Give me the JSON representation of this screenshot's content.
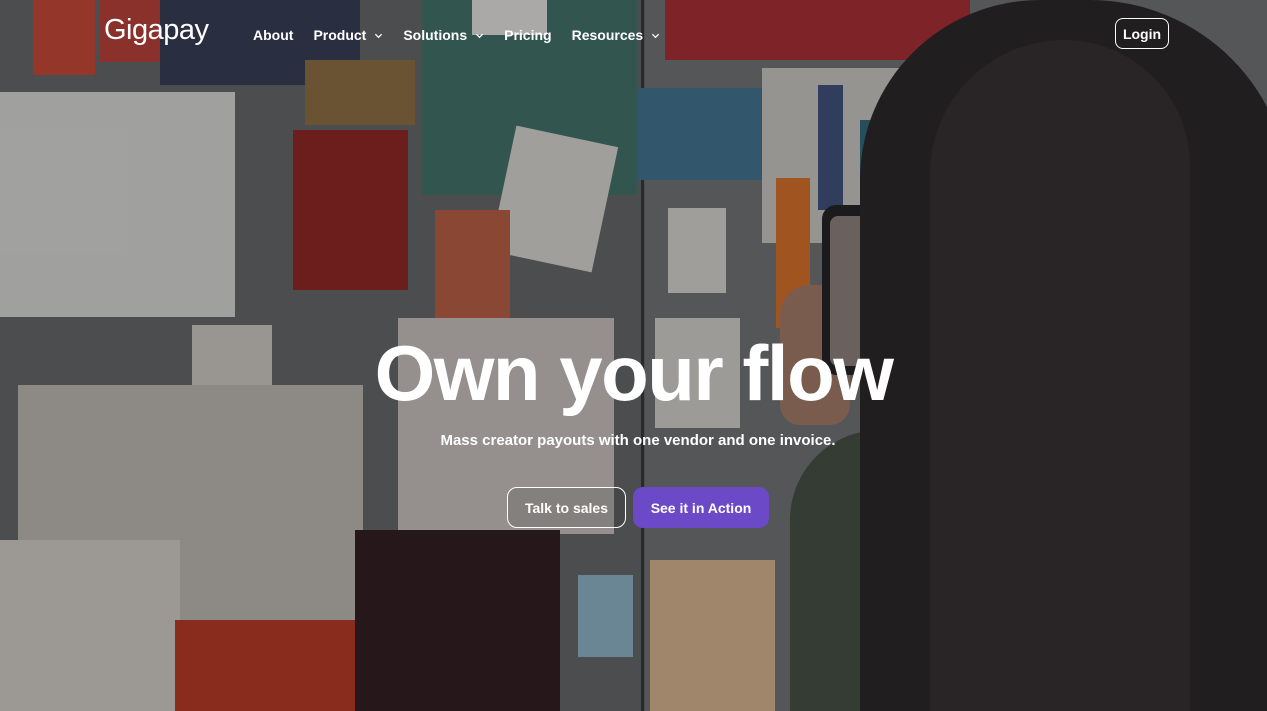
{
  "brand": {
    "logo_text": "Gigapay"
  },
  "nav": {
    "items": [
      {
        "label": "About",
        "has_dropdown": false
      },
      {
        "label": "Product",
        "has_dropdown": true
      },
      {
        "label": "Solutions",
        "has_dropdown": true
      },
      {
        "label": "Pricing",
        "has_dropdown": false
      },
      {
        "label": "Resources",
        "has_dropdown": true
      }
    ],
    "login_label": "Login"
  },
  "hero": {
    "headline": "Own your flow",
    "subheadline": "Mass creator payouts with one vendor and one invoice.",
    "secondary_cta": "Talk to sales",
    "primary_cta": "See it in Action"
  },
  "colors": {
    "primary_button": "#6b49c7",
    "text": "#ffffff"
  }
}
